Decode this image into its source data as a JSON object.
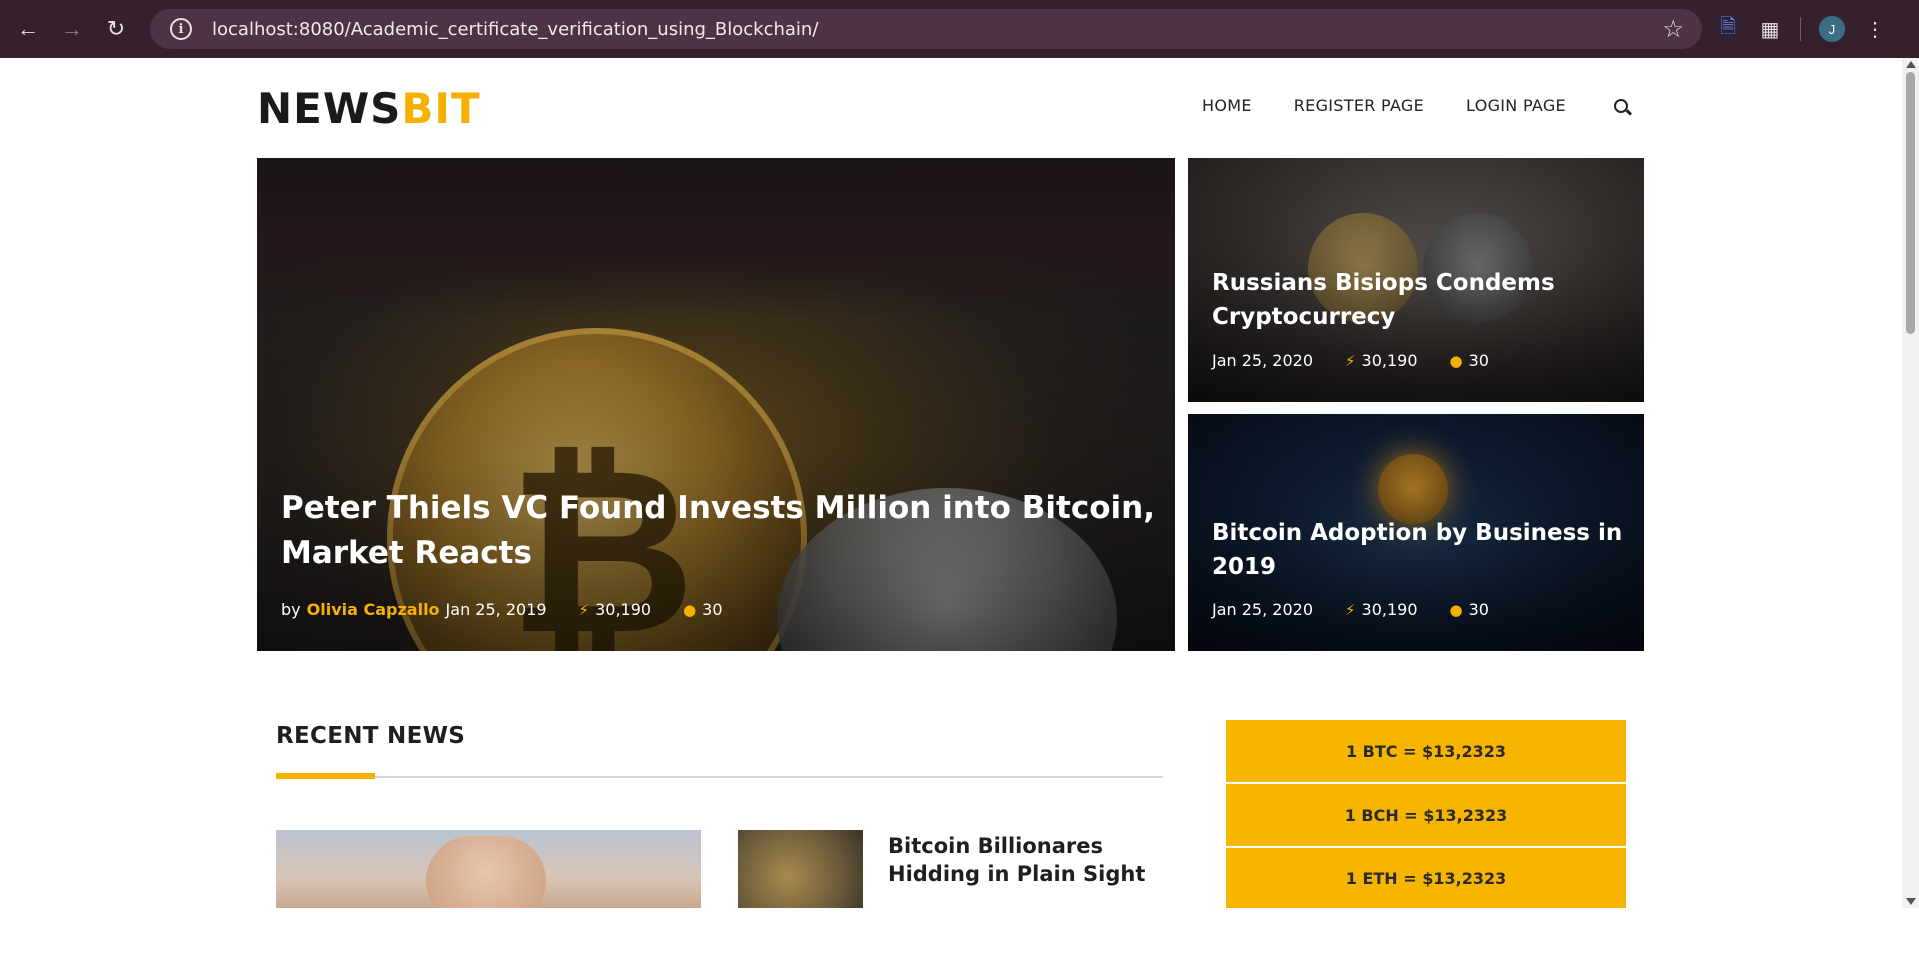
{
  "browser": {
    "url": "localhost:8080/Academic_certificate_verification_using_Blockchain/",
    "profile_initial": "J"
  },
  "site": {
    "logo_primary": "NEWS",
    "logo_accent": "BIT",
    "accent_color": "#f5b000",
    "nav": [
      "HOME",
      "REGISTER PAGE",
      "LOGIN PAGE"
    ]
  },
  "hero": {
    "main": {
      "title_line1": "Peter Thiels VC Found Invests Million into Bitcoin,",
      "title_line2": "Market Reacts",
      "by_label": "by",
      "author": "Olivia Capzallo",
      "date": "Jan 25, 2019",
      "views": "30,190",
      "comments": "30"
    },
    "side": [
      {
        "title_line1": "Russians Bisiops Condems",
        "title_line2": "Cryptocurrecy",
        "date": "Jan 25, 2020",
        "views": "30,190",
        "comments": "30"
      },
      {
        "title_line1": "Bitcoin Adoption by Business in",
        "title_line2": "2019",
        "date": "Jan 25, 2020",
        "views": "30,190",
        "comments": "30"
      }
    ]
  },
  "recent": {
    "heading": "RECENT NEWS",
    "item": {
      "title_line1": "Bitcoin Billionares",
      "title_line2": "Hidding in Plain Sight"
    }
  },
  "prices": [
    "1 BTC = $13,2323",
    "1 BCH = $13,2323",
    "1 ETH = $13,2323"
  ]
}
